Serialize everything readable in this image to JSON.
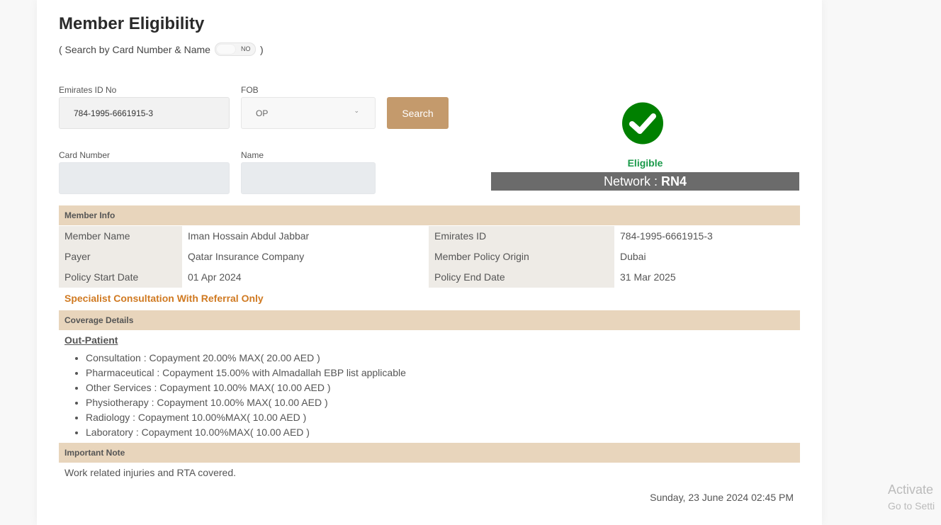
{
  "title": "Member Eligibility",
  "search_toggle": {
    "label_open": "( Search by Card Number & Name",
    "label_close": ")",
    "state": "NO"
  },
  "form": {
    "emirates_id": {
      "label": "Emirates ID No",
      "value": "784-1995-6661915-3"
    },
    "fob": {
      "label": "FOB",
      "value": "OP"
    },
    "search_button": "Search",
    "card_number": {
      "label": "Card Number",
      "value": ""
    },
    "name": {
      "label": "Name",
      "value": ""
    }
  },
  "status": {
    "text": "Eligible",
    "network_label": "Network : ",
    "network_value": "RN4",
    "color": "#008000"
  },
  "member_info": {
    "header": "Member Info",
    "rows": [
      {
        "k1": "Member Name",
        "v1": "Iman Hossain Abdul Jabbar",
        "k2": "Emirates ID",
        "v2": "784-1995-6661915-3"
      },
      {
        "k1": "Payer",
        "v1": "Qatar Insurance Company",
        "k2": "Member Policy Origin",
        "v2": "Dubai"
      },
      {
        "k1": "Policy Start Date",
        "v1": "01 Apr 2024",
        "k2": "Policy End Date",
        "v2": "31 Mar 2025"
      }
    ],
    "referral_note": "Specialist Consultation With Referral Only"
  },
  "coverage": {
    "header": "Coverage Details",
    "category": "Out-Patient",
    "items": [
      "Consultation : Copayment 20.00% MAX( 20.00 AED )",
      "Pharmaceutical : Copayment 15.00% with Almadallah EBP list applicable",
      "Other Services : Copayment 10.00% MAX( 10.00 AED )",
      "Physiotherapy : Copayment 10.00% MAX( 10.00 AED )",
      "Radiology : Copayment 10.00%MAX( 10.00 AED )",
      "Laboratory : Copayment 10.00%MAX( 10.00 AED )"
    ]
  },
  "important_note": {
    "header": "Important Note",
    "text": "Work related injuries and RTA covered."
  },
  "timestamp": "Sunday, 23 June 2024 02:45 PM",
  "watermark": {
    "line1": "Activate",
    "line2": "Go to Setti"
  }
}
